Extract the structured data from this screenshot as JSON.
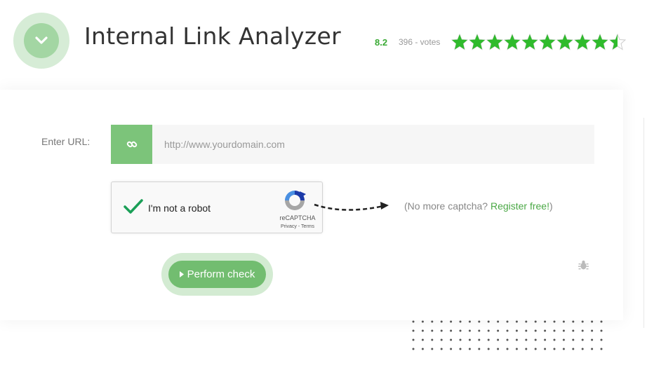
{
  "header": {
    "title": "Internal Link Analyzer",
    "rating_score": "8.2",
    "rating_votes": "396 - votes",
    "stars_filled": 9.5,
    "stars_total": 10
  },
  "form": {
    "url_label": "Enter URL:",
    "url_placeholder": "http://www.yourdomain.com",
    "url_value": "",
    "captcha_label": "I'm not a robot",
    "captcha_brand": "reCAPTCHA",
    "captcha_terms": "Privacy - Terms",
    "nocaptcha_prefix": "(No more captcha? ",
    "nocaptcha_link": "Register free!",
    "nocaptcha_suffix": ")",
    "submit_label": "Perform check"
  },
  "colors": {
    "accent": "#72bd70",
    "star": "#2fbb2c",
    "link": "#4aa845"
  },
  "icons": {
    "logo": "chevron-down-icon",
    "url": "link-icon",
    "captcha_check": "checkmark-icon",
    "report": "bug-icon"
  }
}
